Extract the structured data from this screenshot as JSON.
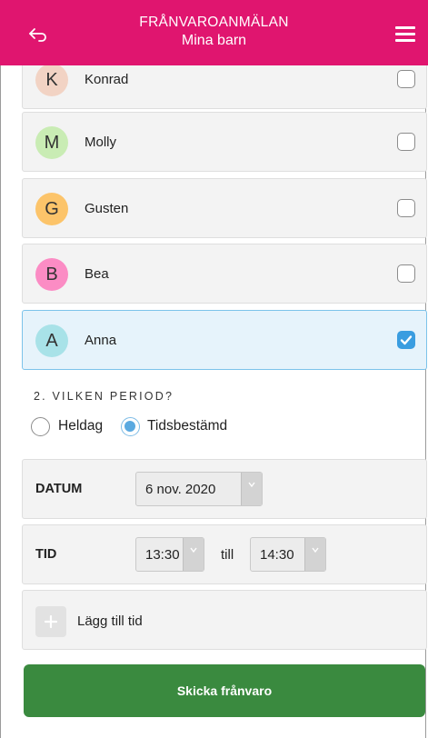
{
  "header": {
    "title": "FRÅNVAROANMÄLAN",
    "subtitle": "Mina barn",
    "back_icon": "back-arrow-icon",
    "menu_icon": "hamburger-menu-icon",
    "color": "#e0156f"
  },
  "children": [
    {
      "initial": "K",
      "name": "Konrad",
      "checked": false,
      "avatar_color": "#f2d3c4"
    },
    {
      "initial": "M",
      "name": "Molly",
      "checked": false,
      "avatar_color": "#c9ecb4"
    },
    {
      "initial": "G",
      "name": "Gusten",
      "checked": false,
      "avatar_color": "#fcc46a"
    },
    {
      "initial": "B",
      "name": "Bea",
      "checked": false,
      "avatar_color": "#fb8cc4"
    },
    {
      "initial": "A",
      "name": "Anna",
      "checked": true,
      "avatar_color": "#a8e2e8"
    }
  ],
  "period": {
    "label": "2. VILKEN PERIOD?",
    "options": [
      {
        "label": "Heldag",
        "selected": false
      },
      {
        "label": "Tidsbestämd",
        "selected": true
      }
    ]
  },
  "date_field": {
    "label": "DATUM",
    "value": "6 nov. 2020"
  },
  "time_field": {
    "label": "TID",
    "from": "13:30",
    "till_label": "till",
    "to": "14:30"
  },
  "add_time": {
    "label": "Lägg till tid"
  },
  "submit": {
    "label": "Skicka frånvaro",
    "color": "#3a8a3f"
  }
}
